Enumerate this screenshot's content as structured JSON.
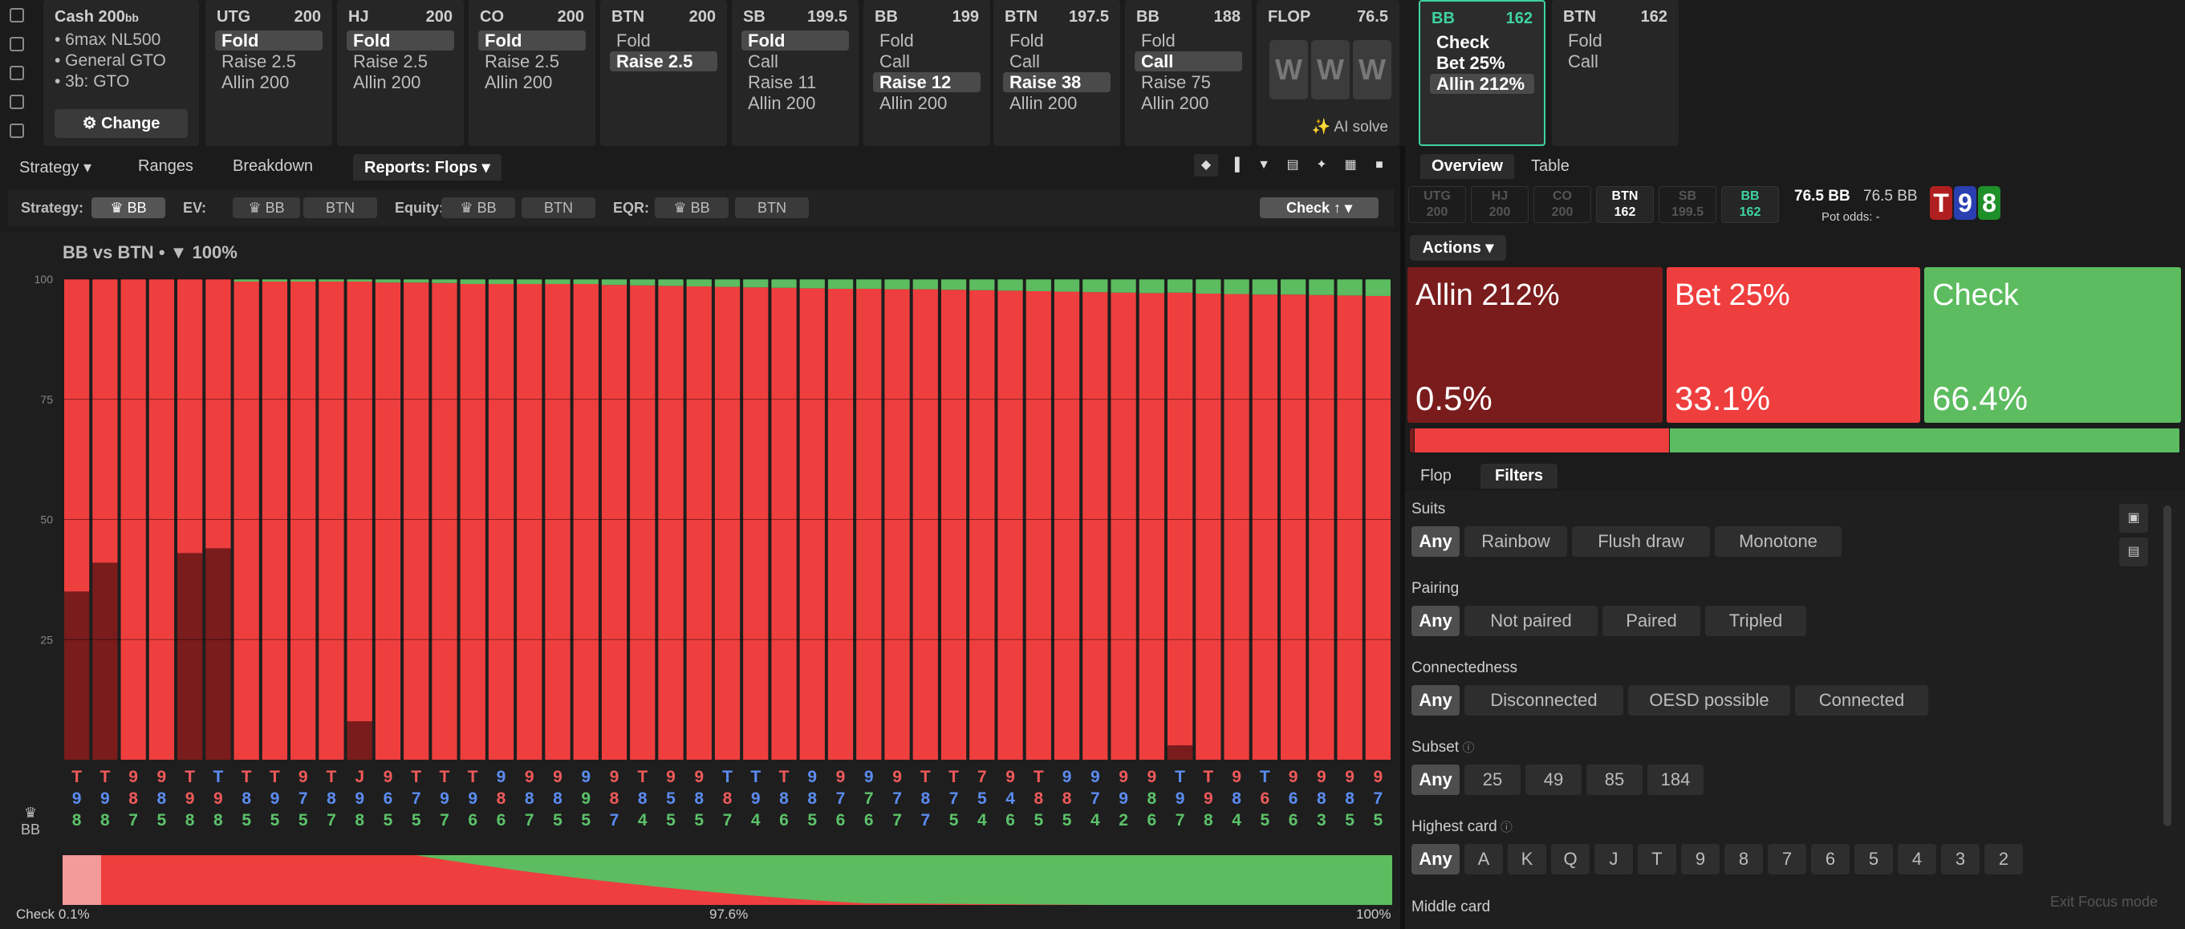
{
  "rail_icons": [
    "bookmark-icon",
    "refresh-icon",
    "save-icon",
    "car-icon",
    "layers-icon"
  ],
  "cash_card": {
    "title": "Cash",
    "stakes": "200",
    "stakes_unit": "bb",
    "lines": [
      "6max NL500",
      "General GTO",
      "3b: GTO"
    ],
    "change_label": "Change"
  },
  "positions": [
    {
      "name": "UTG",
      "stack": "200",
      "actions": [
        {
          "label": "Fold",
          "sel": true
        },
        {
          "label": "Raise 2.5",
          "sel": false
        },
        {
          "label": "Allin 200",
          "sel": false
        }
      ]
    },
    {
      "name": "HJ",
      "stack": "200",
      "actions": [
        {
          "label": "Fold",
          "sel": true
        },
        {
          "label": "Raise 2.5",
          "sel": false
        },
        {
          "label": "Allin 200",
          "sel": false
        }
      ]
    },
    {
      "name": "CO",
      "stack": "200",
      "actions": [
        {
          "label": "Fold",
          "sel": true
        },
        {
          "label": "Raise 2.5",
          "sel": false
        },
        {
          "label": "Allin 200",
          "sel": false
        }
      ]
    },
    {
      "name": "BTN",
      "stack": "200",
      "actions": [
        {
          "label": "Fold",
          "sel": false
        },
        {
          "label": "Raise 2.5",
          "sel": true
        }
      ]
    },
    {
      "name": "SB",
      "stack": "199.5",
      "actions": [
        {
          "label": "Fold",
          "sel": true
        },
        {
          "label": "Call",
          "sel": false
        },
        {
          "label": "Raise 11",
          "sel": false
        },
        {
          "label": "Allin 200",
          "sel": false
        }
      ]
    },
    {
      "name": "BB",
      "stack": "199",
      "actions": [
        {
          "label": "Fold",
          "sel": false
        },
        {
          "label": "Call",
          "sel": false
        },
        {
          "label": "Raise 12",
          "sel": true
        },
        {
          "label": "Allin 200",
          "sel": false
        }
      ]
    },
    {
      "name": "BTN",
      "stack": "197.5",
      "actions": [
        {
          "label": "Fold",
          "sel": false
        },
        {
          "label": "Call",
          "sel": false
        },
        {
          "label": "Raise 38",
          "sel": true
        },
        {
          "label": "Allin 200",
          "sel": false
        }
      ]
    },
    {
      "name": "BB",
      "stack": "188",
      "actions": [
        {
          "label": "Fold",
          "sel": false
        },
        {
          "label": "Call",
          "sel": true
        },
        {
          "label": "Raise 75",
          "sel": false
        },
        {
          "label": "Allin 200",
          "sel": false
        }
      ]
    }
  ],
  "flop_card": {
    "title": "FLOP",
    "pot": "76.5",
    "ai_solve": "AI solve",
    "placeholders": [
      "W",
      "W",
      "W"
    ]
  },
  "bb_card": {
    "name": "BB",
    "stack": "162",
    "actions": [
      {
        "label": "Check"
      },
      {
        "label": "Bet 25%"
      },
      {
        "label": "Allin 212%",
        "sel": true
      }
    ]
  },
  "btn_card": {
    "name": "BTN",
    "stack": "162",
    "actions": [
      {
        "label": "Fold"
      },
      {
        "label": "Call"
      }
    ]
  },
  "left_tabs": [
    {
      "label": "Strategy",
      "caret": true
    },
    {
      "label": "Ranges"
    },
    {
      "label": "Breakdown"
    },
    {
      "label": "Reports: Flops",
      "caret": true,
      "active": true
    }
  ],
  "toolbar_icons": [
    "cube-icon",
    "bar-chart-icon",
    "filter-icon",
    "folder-icon",
    "expand-icon",
    "grid-icon",
    "square-icon"
  ],
  "filterbar": {
    "strategy_label": "Strategy:",
    "ev_label": "EV:",
    "equity_label": "Equity:",
    "eqr_label": "EQR:",
    "bb": "BB",
    "btn": "BTN",
    "sort_label": "Check ↑"
  },
  "report": {
    "title": "BB vs BTN",
    "filter_pct": "100%",
    "side_label": "BB",
    "y_ticks": [
      "100",
      "75",
      "50",
      "25"
    ],
    "bottom_left": "Check 0.1%",
    "bottom_mid": "97.6%",
    "bottom_right": "100%"
  },
  "chart_data": {
    "type": "bar",
    "stacked": true,
    "ylim": [
      0,
      100
    ],
    "colors": {
      "Allin": "#7a1c1c",
      "Bet": "#ef3e3e",
      "Check": "#5cbc5f"
    },
    "categories": [
      "T98",
      "T98",
      "987",
      "985",
      "T98",
      "T98",
      "T85",
      "T95",
      "975",
      "T87",
      "J98",
      "965",
      "T75",
      "T97",
      "T96",
      "986",
      "987",
      "985",
      "995",
      "987",
      "T84",
      "955",
      "985",
      "T87",
      "T94",
      "T86",
      "985",
      "976",
      "976",
      "977",
      "T87",
      "T75",
      "754",
      "946",
      "T85",
      "985",
      "974",
      "992",
      "986",
      "T97",
      "T98",
      "984",
      "T65",
      "966",
      "983",
      "985",
      "975"
    ],
    "suits": [
      [
        "r",
        "b",
        "g"
      ],
      [
        "r",
        "b",
        "g"
      ],
      [
        "r",
        "r",
        "g"
      ],
      [
        "r",
        "b",
        "g"
      ],
      [
        "r",
        "r",
        "g"
      ],
      [
        "b",
        "r",
        "g"
      ],
      [
        "r",
        "b",
        "g"
      ],
      [
        "r",
        "b",
        "g"
      ],
      [
        "r",
        "b",
        "g"
      ],
      [
        "r",
        "b",
        "g"
      ],
      [
        "r",
        "b",
        "g"
      ],
      [
        "r",
        "b",
        "g"
      ],
      [
        "r",
        "b",
        "g"
      ],
      [
        "r",
        "b",
        "g"
      ],
      [
        "r",
        "b",
        "g"
      ],
      [
        "b",
        "r",
        "g"
      ],
      [
        "r",
        "b",
        "g"
      ],
      [
        "r",
        "b",
        "g"
      ],
      [
        "b",
        "g",
        "g"
      ],
      [
        "r",
        "r",
        "b"
      ],
      [
        "r",
        "b",
        "g"
      ],
      [
        "r",
        "b",
        "g"
      ],
      [
        "r",
        "b",
        "g"
      ],
      [
        "b",
        "r",
        "g"
      ],
      [
        "b",
        "b",
        "g"
      ],
      [
        "r",
        "b",
        "g"
      ],
      [
        "b",
        "b",
        "g"
      ],
      [
        "r",
        "b",
        "g"
      ],
      [
        "b",
        "g",
        "g"
      ],
      [
        "r",
        "b",
        "g"
      ],
      [
        "r",
        "b",
        "b"
      ],
      [
        "r",
        "b",
        "g"
      ],
      [
        "r",
        "b",
        "g"
      ],
      [
        "r",
        "b",
        "g"
      ],
      [
        "r",
        "r",
        "g"
      ],
      [
        "b",
        "r",
        "g"
      ],
      [
        "b",
        "b",
        "g"
      ],
      [
        "r",
        "b",
        "g"
      ],
      [
        "r",
        "g",
        "g"
      ],
      [
        "b",
        "b",
        "g"
      ],
      [
        "r",
        "r",
        "g"
      ],
      [
        "r",
        "b",
        "g"
      ],
      [
        "b",
        "r",
        "g"
      ],
      [
        "r",
        "b",
        "g"
      ],
      [
        "r",
        "b",
        "g"
      ],
      [
        "r",
        "b",
        "g"
      ],
      [
        "r",
        "b",
        "g"
      ]
    ],
    "series": [
      {
        "name": "Allin",
        "values": [
          35,
          41,
          0,
          0,
          43,
          44,
          0,
          0,
          0,
          0,
          8,
          0,
          0,
          0,
          0,
          0,
          0,
          0,
          0,
          0,
          0,
          0,
          0,
          0,
          0,
          0,
          0,
          0,
          0,
          0,
          0,
          0,
          0,
          0,
          0,
          0,
          0,
          0,
          0,
          3,
          0,
          0,
          0,
          0,
          0,
          0,
          0
        ]
      },
      {
        "name": "Bet",
        "values": [
          65,
          59,
          100,
          100,
          57,
          56,
          99.5,
          99.5,
          99.5,
          99.5,
          91.5,
          99.3,
          99.3,
          99.2,
          99,
          99,
          99,
          99,
          99,
          98.8,
          98.7,
          98.6,
          98.5,
          98.4,
          98.3,
          98.2,
          98.1,
          98,
          98,
          97.9,
          97.9,
          97.8,
          97.7,
          97.6,
          97.5,
          97.4,
          97.3,
          97.2,
          97.1,
          94.2,
          97,
          96.9,
          96.8,
          96.8,
          96.7,
          96.6,
          96.5
        ]
      },
      {
        "name": "Check",
        "values": [
          0,
          0,
          0,
          0,
          0,
          0,
          0.5,
          0.5,
          0.5,
          0.5,
          0.5,
          0.7,
          0.7,
          0.8,
          1,
          1,
          1,
          1,
          1,
          1.2,
          1.3,
          1.4,
          1.5,
          1.6,
          1.7,
          1.8,
          1.9,
          2,
          2,
          2.1,
          2.1,
          2.2,
          2.3,
          2.4,
          2.5,
          2.6,
          2.7,
          2.8,
          2.9,
          2.8,
          3,
          3.1,
          3.2,
          3.2,
          3.3,
          3.4,
          3.5
        ]
      }
    ]
  },
  "right_tabs": [
    {
      "label": "Overview",
      "active": true
    },
    {
      "label": "Table"
    }
  ],
  "pos_chips": [
    {
      "name": "UTG",
      "stack": "200",
      "dim": true
    },
    {
      "name": "HJ",
      "stack": "200",
      "dim": true
    },
    {
      "name": "CO",
      "stack": "200",
      "dim": true
    },
    {
      "name": "BTN",
      "stack": "162",
      "dim": false
    },
    {
      "name": "SB",
      "stack": "199.5",
      "dim": true
    },
    {
      "name": "BB",
      "stack": "162",
      "dim": false,
      "hl": true
    }
  ],
  "pot": {
    "value": "76.5 BB",
    "value2": "76.5 BB",
    "odds_label": "Pot odds:",
    "odds": "-"
  },
  "board": [
    {
      "rank": "T",
      "color": "#b01f1f"
    },
    {
      "rank": "9",
      "color": "#2a3fb0"
    },
    {
      "rank": "8",
      "color": "#1f8f2a"
    }
  ],
  "actions_label": "Actions",
  "action_tiles": [
    {
      "label": "Allin 212%",
      "pct": "0.5%",
      "frac": 0.005,
      "color": "#7a1c1c"
    },
    {
      "label": "Bet 25%",
      "pct": "33.1%",
      "frac": 0.331,
      "color": "#ef3e3e"
    },
    {
      "label": "Check",
      "pct": "66.4%",
      "frac": 0.664,
      "color": "#5cbc5f"
    }
  ],
  "sub_tabs": [
    {
      "label": "Flop"
    },
    {
      "label": "Filters",
      "active": true
    }
  ],
  "filters": [
    {
      "title": "Suits",
      "help": false,
      "options": [
        "Any",
        "Rainbow",
        "Flush draw",
        "Monotone"
      ]
    },
    {
      "title": "Pairing",
      "help": false,
      "options": [
        "Any",
        "Not paired",
        "Paired",
        "Tripled"
      ]
    },
    {
      "title": "Connectedness",
      "help": false,
      "options": [
        "Any",
        "Disconnected",
        "OESD possible",
        "Connected"
      ]
    },
    {
      "title": "Subset",
      "help": true,
      "options": [
        "Any",
        "25",
        "49",
        "85",
        "184"
      ]
    },
    {
      "title": "Highest card",
      "help": true,
      "options": [
        "Any",
        "A",
        "K",
        "Q",
        "J",
        "T",
        "9",
        "8",
        "7",
        "6",
        "5",
        "4",
        "3",
        "2"
      ]
    }
  ],
  "middle_card_label": "Middle card",
  "exit_focus": "Exit Focus mode"
}
